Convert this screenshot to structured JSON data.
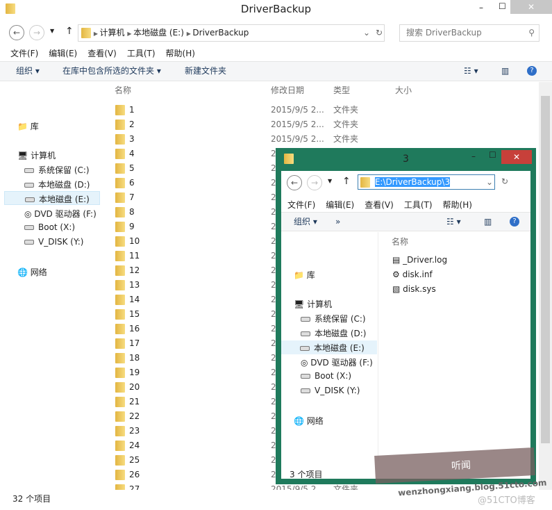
{
  "main": {
    "title": "DriverBackup",
    "breadcrumb": [
      "计算机",
      "本地磁盘 (E:)",
      "DriverBackup"
    ],
    "search_placeholder": "搜索 DriverBackup",
    "menu": [
      "文件(F)",
      "编辑(E)",
      "查看(V)",
      "工具(T)",
      "帮助(H)"
    ],
    "toolbar": {
      "organize": "组织",
      "include": "在库中包含所选的文件夹",
      "new_folder": "新建文件夹"
    },
    "columns": [
      "名称",
      "修改日期",
      "类型",
      "大小"
    ],
    "rows": [
      "1",
      "2",
      "3",
      "4",
      "5",
      "6",
      "7",
      "8",
      "9",
      "10",
      "11",
      "12",
      "13",
      "14",
      "15",
      "16",
      "17",
      "18",
      "19",
      "20",
      "21",
      "22",
      "23",
      "24",
      "25",
      "26",
      "27"
    ],
    "row_date": "2015/9/5 2...",
    "row_type": "文件夹",
    "status": "32 个项目"
  },
  "nav": {
    "library": "库",
    "computer": "计算机",
    "drives": [
      "系统保留 (C:)",
      "本地磁盘 (D:)",
      "本地磁盘 (E:)",
      "DVD 驱动器 (F:)",
      "Boot (X:)",
      "V_DISK (Y:)"
    ],
    "network": "网络"
  },
  "sub": {
    "title": "3",
    "address": "E:\\DriverBackup\\3",
    "menu": [
      "文件(F)",
      "编辑(E)",
      "查看(V)",
      "工具(T)",
      "帮助(H)"
    ],
    "organize": "组织",
    "more": "»",
    "column": "名称",
    "files": [
      {
        "name": "_Driver.log",
        "icon": "log-file-icon"
      },
      {
        "name": "disk.inf",
        "icon": "inf-file-icon"
      },
      {
        "name": "disk.sys",
        "icon": "sys-file-icon"
      }
    ],
    "status": "3 个项目"
  },
  "watermark": {
    "text1": "听闻",
    "text2": "wenzhongxiang.blog.51cto.com",
    "text3": "@51CTO博客"
  },
  "colors": {
    "accent_border": "#1f7a5c",
    "close": "#c7403a",
    "selection": "#cce8ff"
  }
}
